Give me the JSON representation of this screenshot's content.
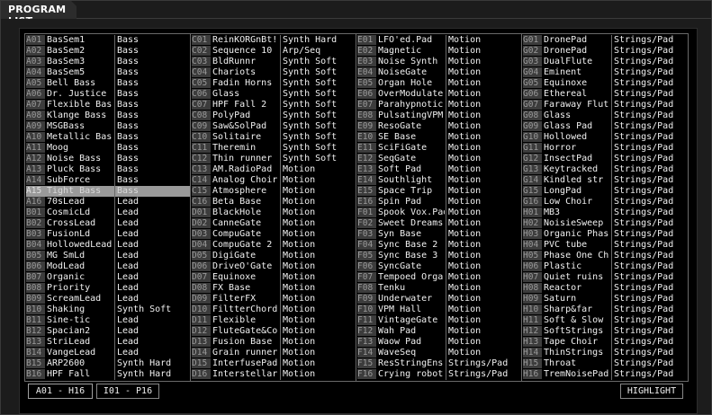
{
  "window": {
    "title": "PROGRAM LIST"
  },
  "columns": [
    [
      [
        "A01",
        "BasSem1",
        "Bass"
      ],
      [
        "A02",
        "BasSem2",
        "Bass"
      ],
      [
        "A03",
        "BasSem3",
        "Bass"
      ],
      [
        "A04",
        "BasSem5",
        "Bass"
      ],
      [
        "A05",
        "Bell Bass",
        "Bass"
      ],
      [
        "A06",
        "Dr. Justice",
        "Bass"
      ],
      [
        "A07",
        "Flexible Bas",
        "Bass"
      ],
      [
        "A08",
        "Klange Bass",
        "Bass"
      ],
      [
        "A09",
        "MSGBass",
        "Bass"
      ],
      [
        "A10",
        "Metallic Bas",
        "Bass"
      ],
      [
        "A11",
        "Moog",
        "Bass"
      ],
      [
        "A12",
        "Noise Bass",
        "Bass"
      ],
      [
        "A13",
        "Pluck Bass",
        "Bass"
      ],
      [
        "A14",
        "SubForce",
        "Bass"
      ],
      [
        "A15",
        "Tight Bass",
        "Bass"
      ],
      [
        "A16",
        "70sLead",
        "Lead"
      ],
      [
        "B01",
        "CosmicLd",
        "Lead"
      ],
      [
        "B02",
        "CrossLead",
        "Lead"
      ],
      [
        "B03",
        "FusionLd",
        "Lead"
      ],
      [
        "B04",
        "HollowedLead",
        "Lead"
      ],
      [
        "B05",
        "MG SmLd",
        "Lead"
      ],
      [
        "B06",
        "ModLead",
        "Lead"
      ],
      [
        "B07",
        "Organic",
        "Lead"
      ],
      [
        "B08",
        "Priority",
        "Lead"
      ],
      [
        "B09",
        "ScreamLead",
        "Lead"
      ],
      [
        "B10",
        "Shaking",
        "Synth Soft"
      ],
      [
        "B11",
        "Sine-tic",
        "Lead"
      ],
      [
        "B12",
        "Spacian2",
        "Lead"
      ],
      [
        "B13",
        "StriLead",
        "Lead"
      ],
      [
        "B14",
        "VangeLead",
        "Lead"
      ],
      [
        "B15",
        "ARP2600",
        "Synth Hard"
      ],
      [
        "B16",
        "HPF Fall",
        "Synth Hard"
      ]
    ],
    [
      [
        "C01",
        "ReinKORGnBt!",
        "Synth Hard"
      ],
      [
        "C02",
        "Sequence 10",
        "Arp/Seq"
      ],
      [
        "C03",
        "BldRunnr",
        "Synth Soft"
      ],
      [
        "C04",
        "Chariots",
        "Synth Soft"
      ],
      [
        "C05",
        "Fadin Horns",
        "Synth Soft"
      ],
      [
        "C06",
        "Glass",
        "Synth Soft"
      ],
      [
        "C07",
        "HPF Fall 2",
        "Synth Soft"
      ],
      [
        "C08",
        "PolyPad",
        "Synth Soft"
      ],
      [
        "C09",
        "Saw&SolPad",
        "Synth Soft"
      ],
      [
        "C10",
        "Solitaire",
        "Synth Soft"
      ],
      [
        "C11",
        "Theremin",
        "Synth Soft"
      ],
      [
        "C12",
        "Thin runner",
        "Synth Soft"
      ],
      [
        "C13",
        "AM.RadioPad",
        "Motion"
      ],
      [
        "C14",
        "Analog Choir",
        "Motion"
      ],
      [
        "C15",
        "Atmosphere",
        "Motion"
      ],
      [
        "C16",
        "Beta Base",
        "Motion"
      ],
      [
        "D01",
        "BlackHole",
        "Motion"
      ],
      [
        "D02",
        "CanneGate",
        "Motion"
      ],
      [
        "D03",
        "CompuGate",
        "Motion"
      ],
      [
        "D04",
        "CompuGate 2",
        "Motion"
      ],
      [
        "D05",
        "DigiGate",
        "Motion"
      ],
      [
        "D06",
        "DriveO'Gate",
        "Motion"
      ],
      [
        "D07",
        "Equinoxe",
        "Motion"
      ],
      [
        "D08",
        "FX Base",
        "Motion"
      ],
      [
        "D09",
        "FilterFX",
        "Motion"
      ],
      [
        "D10",
        "FiltterChord",
        "Motion"
      ],
      [
        "D11",
        "Flexible",
        "Motion"
      ],
      [
        "D12",
        "FluteGate&Co",
        "Motion"
      ],
      [
        "D13",
        "Fusion Base",
        "Motion"
      ],
      [
        "D14",
        "Grain runner",
        "Motion"
      ],
      [
        "D15",
        "InterfusePad",
        "Motion"
      ],
      [
        "D16",
        "Interstellar",
        "Motion"
      ]
    ],
    [
      [
        "E01",
        "LFO'ed.Pad",
        "Motion"
      ],
      [
        "E02",
        "Magnetic",
        "Motion"
      ],
      [
        "E03",
        "Noise Synth",
        "Motion"
      ],
      [
        "E04",
        "NoiseGate",
        "Motion"
      ],
      [
        "E05",
        "Organ Hole",
        "Motion"
      ],
      [
        "E06",
        "OverModulate",
        "Motion"
      ],
      [
        "E07",
        "Parahypnotic",
        "Motion"
      ],
      [
        "E08",
        "PulsatingVPM",
        "Motion"
      ],
      [
        "E09",
        "ResoGate",
        "Motion"
      ],
      [
        "E10",
        "SE Base",
        "Motion"
      ],
      [
        "E11",
        "SciFiGate",
        "Motion"
      ],
      [
        "E12",
        "SeqGate",
        "Motion"
      ],
      [
        "E13",
        "Soft Pad",
        "Motion"
      ],
      [
        "E14",
        "Southlight",
        "Motion"
      ],
      [
        "E15",
        "Space Trip",
        "Motion"
      ],
      [
        "E16",
        "Spin Pad",
        "Motion"
      ],
      [
        "F01",
        "Spook Vox.Pad",
        "Motion"
      ],
      [
        "F02",
        "Sweet Dreams",
        "Motion"
      ],
      [
        "F03",
        "Syn Base",
        "Motion"
      ],
      [
        "F04",
        "Sync Base 2",
        "Motion"
      ],
      [
        "F05",
        "Sync Base 3",
        "Motion"
      ],
      [
        "F06",
        "SyncGate",
        "Motion"
      ],
      [
        "F07",
        "Tempoed Orga",
        "Motion"
      ],
      [
        "F08",
        "Tenku",
        "Motion"
      ],
      [
        "F09",
        "Underwater",
        "Motion"
      ],
      [
        "F10",
        "VPM Hall",
        "Motion"
      ],
      [
        "F11",
        "VintageGate",
        "Motion"
      ],
      [
        "F12",
        "Wah Pad",
        "Motion"
      ],
      [
        "F13",
        "Waow Pad",
        "Motion"
      ],
      [
        "F14",
        "WaveSeq",
        "Motion"
      ],
      [
        "F15",
        "ResStringEns",
        "Strings/Pad"
      ],
      [
        "F16",
        "Crying robot",
        "Strings/Pad"
      ]
    ],
    [
      [
        "G01",
        "DronePad",
        "Strings/Pad"
      ],
      [
        "G02",
        "DronePad",
        "Strings/Pad"
      ],
      [
        "G03",
        "DualFlute",
        "Strings/Pad"
      ],
      [
        "G04",
        "Eminent",
        "Strings/Pad"
      ],
      [
        "G05",
        "Equinoxe",
        "Strings/Pad"
      ],
      [
        "G06",
        "Ethereal",
        "Strings/Pad"
      ],
      [
        "G07",
        "Faraway Flut",
        "Strings/Pad"
      ],
      [
        "G08",
        "Glass",
        "Strings/Pad"
      ],
      [
        "G09",
        "Glass Pad",
        "Strings/Pad"
      ],
      [
        "G10",
        "Hollowed",
        "Strings/Pad"
      ],
      [
        "G11",
        "Horror",
        "Strings/Pad"
      ],
      [
        "G12",
        "InsectPad",
        "Strings/Pad"
      ],
      [
        "G13",
        "Keytracked",
        "Strings/Pad"
      ],
      [
        "G14",
        "Kindled str",
        "Strings/Pad"
      ],
      [
        "G15",
        "LongPad",
        "Strings/Pad"
      ],
      [
        "G16",
        "Low Choir",
        "Strings/Pad"
      ],
      [
        "H01",
        "MB3",
        "Strings/Pad"
      ],
      [
        "H02",
        "NoisieSweep",
        "Strings/Pad"
      ],
      [
        "H03",
        "Organic Phas",
        "Strings/Pad"
      ],
      [
        "H04",
        "PVC tube",
        "Strings/Pad"
      ],
      [
        "H05",
        "Phase One Ch",
        "Strings/Pad"
      ],
      [
        "H06",
        "Plastic",
        "Strings/Pad"
      ],
      [
        "H07",
        "Quiet ruins",
        "Strings/Pad"
      ],
      [
        "H08",
        "Reactor",
        "Strings/Pad"
      ],
      [
        "H09",
        "Saturn",
        "Strings/Pad"
      ],
      [
        "H10",
        "Sharp&far",
        "Strings/Pad"
      ],
      [
        "H11",
        "Soft & Slow",
        "Strings/Pad"
      ],
      [
        "H12",
        "SoftStrings",
        "Strings/Pad"
      ],
      [
        "H13",
        "Tape Choir",
        "Strings/Pad"
      ],
      [
        "H14",
        "ThinStrings",
        "Strings/Pad"
      ],
      [
        "H15",
        "Throat",
        "Strings/Pad"
      ],
      [
        "H16",
        "TremNoisePad",
        "Strings/Pad"
      ]
    ]
  ],
  "selected": "A15",
  "bank_buttons": {
    "a_h": "A01 - H16",
    "i_p": "I01 - P16"
  },
  "highlight_label": "HIGHLIGHT"
}
